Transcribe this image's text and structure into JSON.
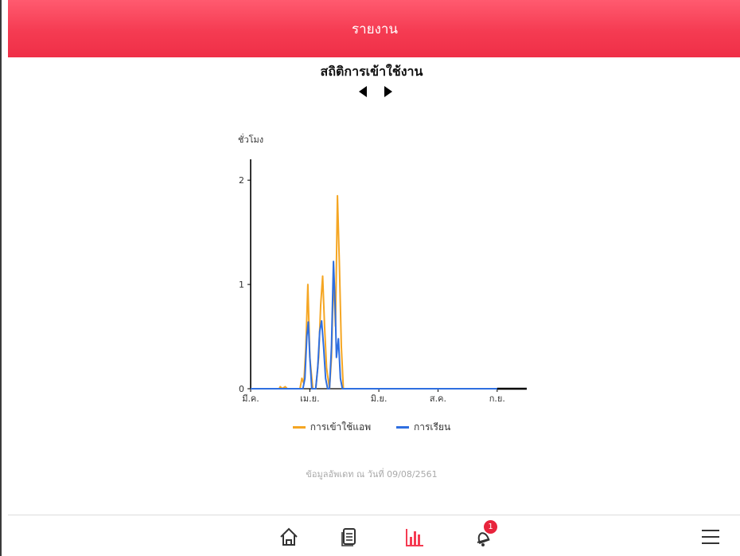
{
  "header": {
    "title": "รายงาน"
  },
  "page": {
    "title": "สถิติการเข้าใช้งาน",
    "updated_text": "ข้อมูลอัพเดท ณ วันที่ 09/08/2561"
  },
  "nav": {
    "prev_icon": "triangle-left",
    "next_icon": "triangle-right"
  },
  "tabs": [
    {
      "name": "home",
      "icon": "home-icon"
    },
    {
      "name": "documents",
      "icon": "document-icon"
    },
    {
      "name": "report",
      "icon": "bar-chart-icon",
      "active": true
    },
    {
      "name": "notifications",
      "icon": "bell-icon",
      "badge": "1"
    },
    {
      "name": "menu",
      "icon": "hamburger-icon"
    }
  ],
  "colors": {
    "accent": "#f53b52",
    "series_app": "#f5a623",
    "series_learn": "#2f6fe0",
    "axis": "#000000"
  },
  "chart_data": {
    "type": "line",
    "ylabel": "ชั่วโมง",
    "ylim": [
      0,
      2.2
    ],
    "yticks": [
      0,
      1,
      2
    ],
    "xlim": [
      0,
      28
    ],
    "xticks": [
      {
        "x": 0,
        "label": "มี.ค."
      },
      {
        "x": 6,
        "label": "เม.ย."
      },
      {
        "x": 13,
        "label": "มิ.ย."
      },
      {
        "x": 19,
        "label": "ส.ค."
      },
      {
        "x": 25,
        "label": "ก.ย."
      }
    ],
    "series": [
      {
        "name": "การเข้าใช้แอพ",
        "color": "#f5a623",
        "points": [
          [
            0,
            0
          ],
          [
            2.9,
            0
          ],
          [
            3.0,
            0.02
          ],
          [
            3.2,
            0
          ],
          [
            3.5,
            0.02
          ],
          [
            3.7,
            0
          ],
          [
            5.0,
            0
          ],
          [
            5.2,
            0.1
          ],
          [
            5.4,
            0.05
          ],
          [
            5.6,
            0.4
          ],
          [
            5.8,
            1.0
          ],
          [
            6.0,
            0.3
          ],
          [
            6.3,
            0
          ],
          [
            6.6,
            0
          ],
          [
            6.9,
            0.3
          ],
          [
            7.1,
            0.8
          ],
          [
            7.3,
            1.08
          ],
          [
            7.5,
            0.6
          ],
          [
            7.7,
            0.2
          ],
          [
            8.0,
            0
          ],
          [
            8.2,
            0.3
          ],
          [
            8.4,
            1.1
          ],
          [
            8.6,
            0.6
          ],
          [
            8.8,
            1.85
          ],
          [
            9.0,
            1.2
          ],
          [
            9.2,
            0.4
          ],
          [
            9.4,
            0
          ],
          [
            28,
            0
          ]
        ]
      },
      {
        "name": "การเรียน",
        "color": "#2f6fe0",
        "points": [
          [
            0,
            0
          ],
          [
            5.3,
            0
          ],
          [
            5.5,
            0.1
          ],
          [
            5.7,
            0.5
          ],
          [
            5.85,
            0.64
          ],
          [
            6.0,
            0.3
          ],
          [
            6.2,
            0
          ],
          [
            6.6,
            0
          ],
          [
            6.8,
            0.2
          ],
          [
            7.0,
            0.55
          ],
          [
            7.2,
            0.65
          ],
          [
            7.4,
            0.4
          ],
          [
            7.6,
            0.1
          ],
          [
            7.8,
            0
          ],
          [
            8.0,
            0
          ],
          [
            8.2,
            0.4
          ],
          [
            8.4,
            1.22
          ],
          [
            8.6,
            0.7
          ],
          [
            8.7,
            0.3
          ],
          [
            8.9,
            0.48
          ],
          [
            9.1,
            0.1
          ],
          [
            9.3,
            0
          ],
          [
            28,
            0
          ]
        ]
      }
    ],
    "grid": false,
    "legend": "bottom-center"
  }
}
